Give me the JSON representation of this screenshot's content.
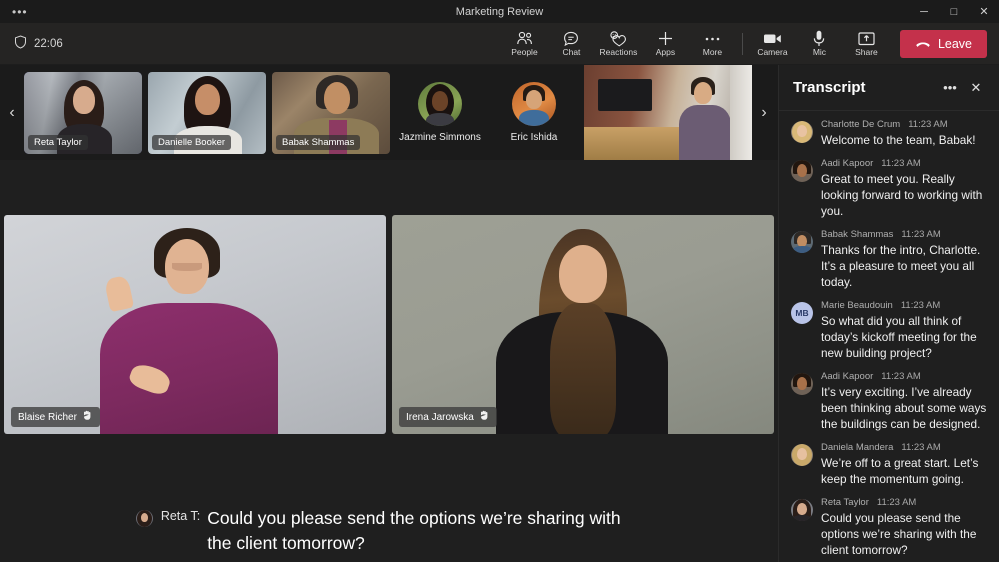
{
  "window": {
    "title": "Marketing Review",
    "overflow_label": "•••",
    "minimize_label": "─",
    "maximize_label": "□",
    "close_label": "✕"
  },
  "actionbar": {
    "shield_icon": "shield-icon",
    "timer": "22:06",
    "tools": [
      {
        "label": "People",
        "icon": "people-icon"
      },
      {
        "label": "Chat",
        "icon": "chat-icon"
      },
      {
        "label": "Reactions",
        "icon": "reactions-icon"
      },
      {
        "label": "Apps",
        "icon": "plus-icon"
      },
      {
        "label": "More",
        "icon": "more-icon"
      }
    ],
    "devices": [
      {
        "label": "Camera",
        "icon": "camera-icon"
      },
      {
        "label": "Mic",
        "icon": "microphone-icon"
      },
      {
        "label": "Share",
        "icon": "share-screen-icon"
      }
    ],
    "leave_label": "Leave",
    "leave_icon": "hangup-icon",
    "leave_color": "#c4314b"
  },
  "filmstrip": {
    "prev_label": "‹",
    "next_label": "›",
    "active_outline_color": "#6264a7",
    "video_tiles": [
      {
        "name": "Reta Taylor",
        "active": true
      },
      {
        "name": "Danielle Booker",
        "active": false
      },
      {
        "name": "Babak Shammas",
        "active": false
      }
    ],
    "audio_tiles": [
      {
        "name": "Jazmine Simmons"
      },
      {
        "name": "Eric Ishida"
      }
    ],
    "room_tile": {
      "name": "Conference room"
    }
  },
  "stage": {
    "tiles": [
      {
        "name": "Blaise Richer",
        "sign_icon": "sign-language-icon"
      },
      {
        "name": "Irena Jarowska",
        "sign_icon": "sign-language-icon"
      }
    ]
  },
  "caption": {
    "avatar": "reta-taylor-avatar",
    "speaker": "Reta T:",
    "text": "Could you please send the options we’re sharing with the client tomorrow?"
  },
  "transcript": {
    "title": "Transcript",
    "more_label": "•••",
    "close_label": "✕",
    "entries": [
      {
        "speaker": "Charlotte De Crum",
        "time": "11:23 AM",
        "message": "Welcome to the team, Babak!",
        "avatar_type": "photo",
        "initials": ""
      },
      {
        "speaker": "Aadi Kapoor",
        "time": "11:23 AM",
        "message": "Great to meet you. Really looking forward to working with you.",
        "avatar_type": "photo",
        "initials": ""
      },
      {
        "speaker": "Babak Shammas",
        "time": "11:23 AM",
        "message": "Thanks for the intro, Charlotte. It’s a pleasure to meet you all today.",
        "avatar_type": "photo",
        "initials": ""
      },
      {
        "speaker": "Marie Beaudouin",
        "time": "11:23 AM",
        "message": "So what did you all think of today’s kickoff meeting for the new building project?",
        "avatar_type": "initials",
        "initials": "MB"
      },
      {
        "speaker": "Aadi Kapoor",
        "time": "11:23 AM",
        "message": "It’s very exciting. I’ve already been thinking about some ways the buildings can be designed.",
        "avatar_type": "photo",
        "initials": ""
      },
      {
        "speaker": "Daniela Mandera",
        "time": "11:23 AM",
        "message": "We’re off to a great start. Let’s keep the momentum going.",
        "avatar_type": "photo",
        "initials": ""
      },
      {
        "speaker": "Reta Taylor",
        "time": "11:23 AM",
        "message": "Could you please send the options we’re sharing with the client tomorrow?",
        "avatar_type": "photo",
        "initials": ""
      }
    ]
  }
}
